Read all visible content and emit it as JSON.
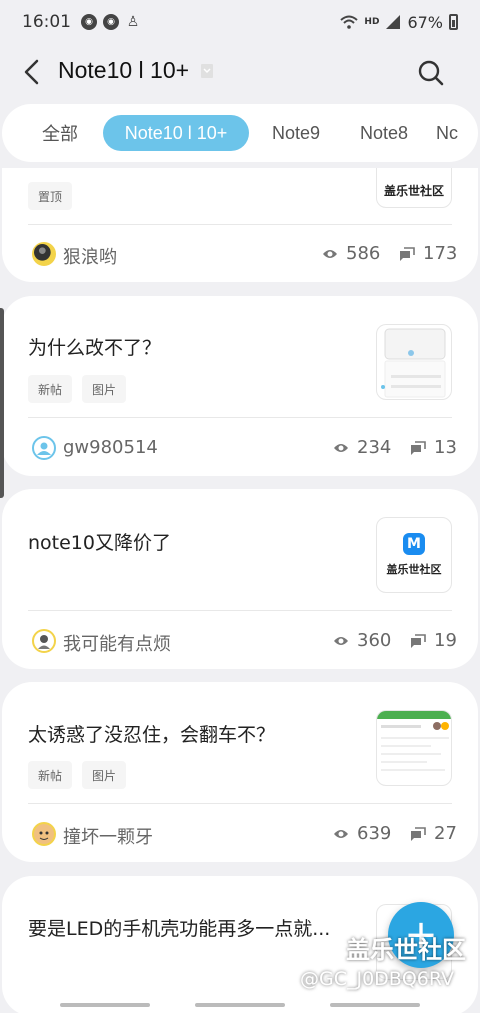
{
  "status_bar": {
    "time": "16:01",
    "battery": "67%",
    "network": "HD"
  },
  "header": {
    "title": "Note10 l 10+"
  },
  "tabs": [
    {
      "label": "全部",
      "active": false
    },
    {
      "label": "Note10 l 10+",
      "active": true
    },
    {
      "label": "Note9",
      "active": false
    },
    {
      "label": "Note8",
      "active": false
    },
    {
      "label": "Nc",
      "active": false
    }
  ],
  "posts": [
    {
      "title": "",
      "tags": [
        "置顶"
      ],
      "author": "狠浪哟",
      "views": "586",
      "comments": "173",
      "thumb": "盖乐世社区"
    },
    {
      "title": "为什么改不了？",
      "tags": [
        "新帖",
        "图片"
      ],
      "author": "gw980514",
      "views": "234",
      "comments": "13"
    },
    {
      "title": "note10又降价了",
      "tags": [],
      "author": "我可能有点烦",
      "views": "360",
      "comments": "19",
      "thumb": "盖乐世社区"
    },
    {
      "title": "太诱惑了没忍住，会翻车不？",
      "tags": [
        "新帖",
        "图片"
      ],
      "author": "撞坏一颗牙",
      "views": "639",
      "comments": "27"
    },
    {
      "title": "要是LED的手机壳功能再多一点就...",
      "tags": [],
      "author": "",
      "views": "",
      "comments": ""
    }
  ],
  "fab": {
    "label": "+"
  },
  "watermark": {
    "line1": "盖乐世社区",
    "line2": "@GC_J0DBQ6RV"
  },
  "colors": {
    "accent": "#6cc4ea",
    "fab": "#2ba6e2",
    "background": "#f0f0f3"
  }
}
